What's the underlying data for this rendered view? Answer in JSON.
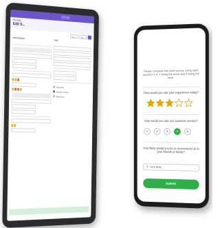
{
  "tablet": {
    "breadcrumb": "Surveys",
    "title": "Edit S...",
    "toolbar": [
      "Pre...",
      "Sa..."
    ],
    "left_col_heading": "Introduction",
    "right_col_heading": "Title",
    "checks": [
      "Required",
      "Display survey",
      "Show title"
    ],
    "colors": {
      "accent": "#6e56c8",
      "highlight": "#d5efd8",
      "pill_a": "#f0b429",
      "pill_b": "#e76f51"
    }
  },
  "phone": {
    "intro_text": "Please complete this short survey, using each question 1-5, 1 being the worst and 5 being the best.",
    "q1": "How would you rate your experience today?",
    "q1_rating": 3,
    "q1_max": 5,
    "q2": "How would you rate our customer service?",
    "q2_options": [
      "1",
      "2",
      "3",
      "4",
      "5"
    ],
    "q2_selected": "4",
    "q3": "How likely would you be to recommend us to your friends or family?",
    "q3_value": "5 - Very likely",
    "submit_label": "Submit",
    "colors": {
      "accent": "#2fae49",
      "star": "#e0a800"
    }
  }
}
